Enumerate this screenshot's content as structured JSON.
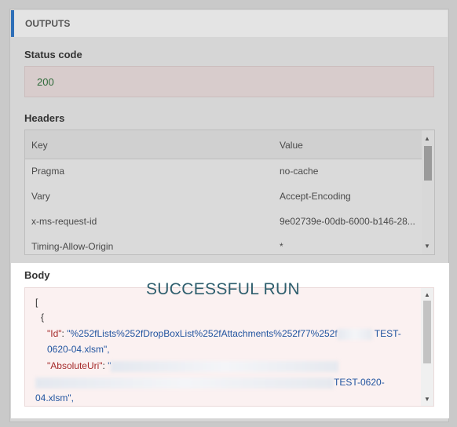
{
  "outputs": {
    "title": "OUTPUTS"
  },
  "status": {
    "label": "Status code",
    "value": "200"
  },
  "headers": {
    "label": "Headers",
    "columns": [
      "Key",
      "Value"
    ],
    "rows": [
      {
        "key": "Pragma",
        "value": "no-cache"
      },
      {
        "key": "Vary",
        "value": "Accept-Encoding"
      },
      {
        "key": "x-ms-request-id",
        "value": "9e02739e-00db-6000-b146-28..."
      },
      {
        "key": "Timing-Allow-Origin",
        "value": "*"
      }
    ]
  },
  "body": {
    "label": "Body",
    "overlay": "SUCCESSFUL RUN",
    "lines": {
      "open_bracket": "[",
      "open_brace": "{",
      "id_key": "\"Id\"",
      "id_value": "\"%252fLists%252fDropBoxList%252fAttachments%252f77%252f",
      "id_tail": "TEST-",
      "id_tail2": "0620-04.xlsm\",",
      "uri_key": "\"AbsoluteUri\"",
      "uri_open": "\"",
      "uri_tail": "TEST-0620-",
      "uri_tail2": "04.xlsm\","
    }
  }
}
